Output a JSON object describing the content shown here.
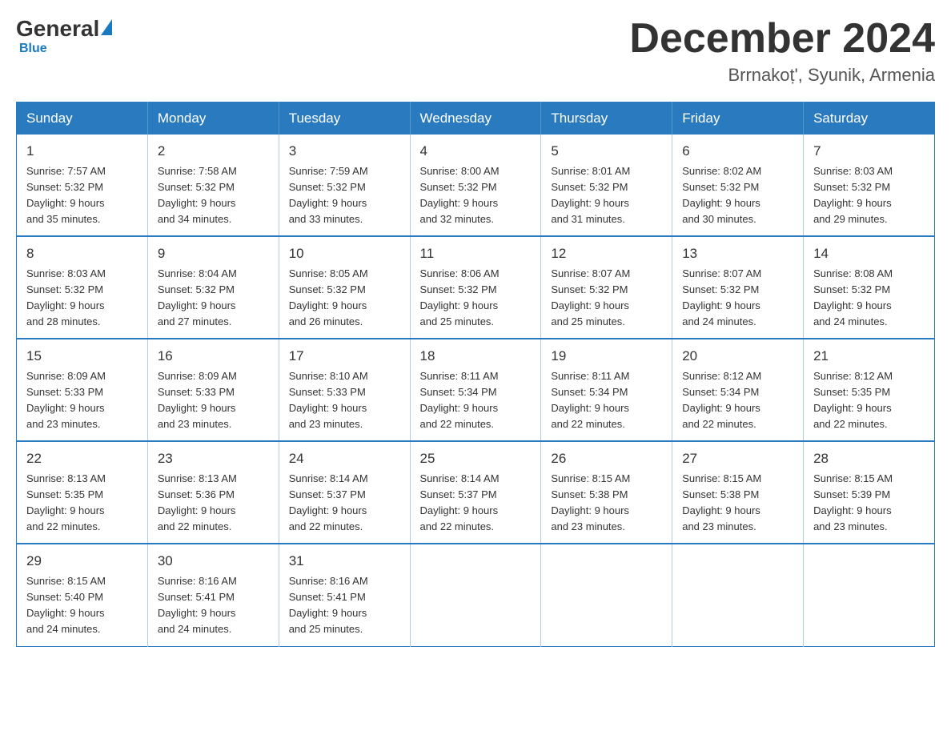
{
  "header": {
    "logo": {
      "general": "General",
      "blue": "Blue"
    },
    "title": "December 2024",
    "location": "Brrnakoṭ', Syunik, Armenia"
  },
  "days_of_week": [
    "Sunday",
    "Monday",
    "Tuesday",
    "Wednesday",
    "Thursday",
    "Friday",
    "Saturday"
  ],
  "weeks": [
    [
      {
        "day": "1",
        "sunrise": "7:57 AM",
        "sunset": "5:32 PM",
        "daylight": "9 hours and 35 minutes."
      },
      {
        "day": "2",
        "sunrise": "7:58 AM",
        "sunset": "5:32 PM",
        "daylight": "9 hours and 34 minutes."
      },
      {
        "day": "3",
        "sunrise": "7:59 AM",
        "sunset": "5:32 PM",
        "daylight": "9 hours and 33 minutes."
      },
      {
        "day": "4",
        "sunrise": "8:00 AM",
        "sunset": "5:32 PM",
        "daylight": "9 hours and 32 minutes."
      },
      {
        "day": "5",
        "sunrise": "8:01 AM",
        "sunset": "5:32 PM",
        "daylight": "9 hours and 31 minutes."
      },
      {
        "day": "6",
        "sunrise": "8:02 AM",
        "sunset": "5:32 PM",
        "daylight": "9 hours and 30 minutes."
      },
      {
        "day": "7",
        "sunrise": "8:03 AM",
        "sunset": "5:32 PM",
        "daylight": "9 hours and 29 minutes."
      }
    ],
    [
      {
        "day": "8",
        "sunrise": "8:03 AM",
        "sunset": "5:32 PM",
        "daylight": "9 hours and 28 minutes."
      },
      {
        "day": "9",
        "sunrise": "8:04 AM",
        "sunset": "5:32 PM",
        "daylight": "9 hours and 27 minutes."
      },
      {
        "day": "10",
        "sunrise": "8:05 AM",
        "sunset": "5:32 PM",
        "daylight": "9 hours and 26 minutes."
      },
      {
        "day": "11",
        "sunrise": "8:06 AM",
        "sunset": "5:32 PM",
        "daylight": "9 hours and 25 minutes."
      },
      {
        "day": "12",
        "sunrise": "8:07 AM",
        "sunset": "5:32 PM",
        "daylight": "9 hours and 25 minutes."
      },
      {
        "day": "13",
        "sunrise": "8:07 AM",
        "sunset": "5:32 PM",
        "daylight": "9 hours and 24 minutes."
      },
      {
        "day": "14",
        "sunrise": "8:08 AM",
        "sunset": "5:32 PM",
        "daylight": "9 hours and 24 minutes."
      }
    ],
    [
      {
        "day": "15",
        "sunrise": "8:09 AM",
        "sunset": "5:33 PM",
        "daylight": "9 hours and 23 minutes."
      },
      {
        "day": "16",
        "sunrise": "8:09 AM",
        "sunset": "5:33 PM",
        "daylight": "9 hours and 23 minutes."
      },
      {
        "day": "17",
        "sunrise": "8:10 AM",
        "sunset": "5:33 PM",
        "daylight": "9 hours and 23 minutes."
      },
      {
        "day": "18",
        "sunrise": "8:11 AM",
        "sunset": "5:34 PM",
        "daylight": "9 hours and 22 minutes."
      },
      {
        "day": "19",
        "sunrise": "8:11 AM",
        "sunset": "5:34 PM",
        "daylight": "9 hours and 22 minutes."
      },
      {
        "day": "20",
        "sunrise": "8:12 AM",
        "sunset": "5:34 PM",
        "daylight": "9 hours and 22 minutes."
      },
      {
        "day": "21",
        "sunrise": "8:12 AM",
        "sunset": "5:35 PM",
        "daylight": "9 hours and 22 minutes."
      }
    ],
    [
      {
        "day": "22",
        "sunrise": "8:13 AM",
        "sunset": "5:35 PM",
        "daylight": "9 hours and 22 minutes."
      },
      {
        "day": "23",
        "sunrise": "8:13 AM",
        "sunset": "5:36 PM",
        "daylight": "9 hours and 22 minutes."
      },
      {
        "day": "24",
        "sunrise": "8:14 AM",
        "sunset": "5:37 PM",
        "daylight": "9 hours and 22 minutes."
      },
      {
        "day": "25",
        "sunrise": "8:14 AM",
        "sunset": "5:37 PM",
        "daylight": "9 hours and 22 minutes."
      },
      {
        "day": "26",
        "sunrise": "8:15 AM",
        "sunset": "5:38 PM",
        "daylight": "9 hours and 23 minutes."
      },
      {
        "day": "27",
        "sunrise": "8:15 AM",
        "sunset": "5:38 PM",
        "daylight": "9 hours and 23 minutes."
      },
      {
        "day": "28",
        "sunrise": "8:15 AM",
        "sunset": "5:39 PM",
        "daylight": "9 hours and 23 minutes."
      }
    ],
    [
      {
        "day": "29",
        "sunrise": "8:15 AM",
        "sunset": "5:40 PM",
        "daylight": "9 hours and 24 minutes."
      },
      {
        "day": "30",
        "sunrise": "8:16 AM",
        "sunset": "5:41 PM",
        "daylight": "9 hours and 24 minutes."
      },
      {
        "day": "31",
        "sunrise": "8:16 AM",
        "sunset": "5:41 PM",
        "daylight": "9 hours and 25 minutes."
      },
      null,
      null,
      null,
      null
    ]
  ],
  "labels": {
    "sunrise": "Sunrise:",
    "sunset": "Sunset:",
    "daylight": "Daylight:"
  }
}
